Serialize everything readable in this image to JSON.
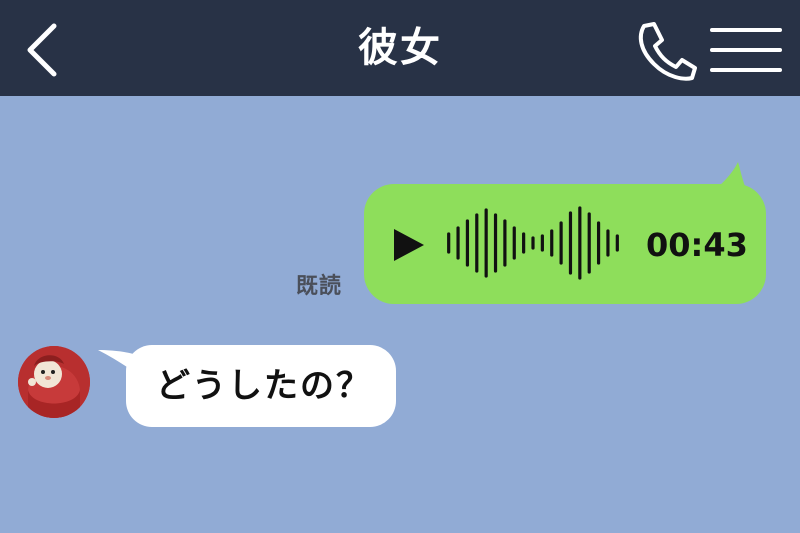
{
  "header": {
    "back_icon": "chevron-left-icon",
    "title": "彼女",
    "call_icon": "phone-icon",
    "menu_icon": "hamburger-menu-icon"
  },
  "messages": [
    {
      "direction": "sent",
      "type": "voice",
      "play_icon": "play-icon",
      "waveform_icon": "audio-waveform-icon",
      "duration": "00:43",
      "read_status": "既読"
    },
    {
      "direction": "received",
      "type": "text",
      "avatar_icon": "avatar",
      "text": "どうしたの？"
    }
  ],
  "colors": {
    "header_bg": "#283246",
    "chat_bg": "#91abd5",
    "sent_bubble": "#8ede5b",
    "received_bubble": "#ffffff"
  }
}
